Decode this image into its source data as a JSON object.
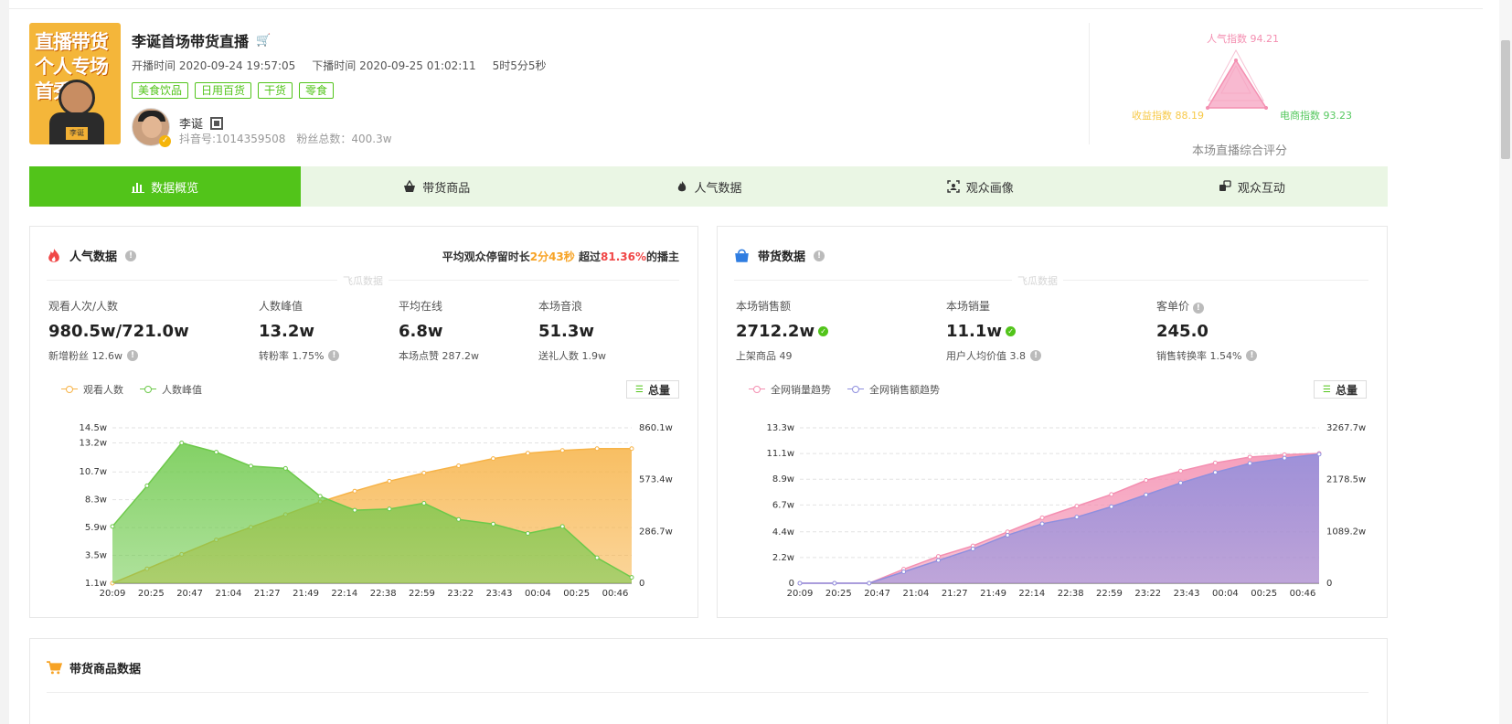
{
  "room": {
    "cover_text": "直播带货个人专场首秀",
    "cover_name": "李诞",
    "title": "李诞首场带货直播",
    "start_label": "开播时间",
    "start_time": "2020-09-24 19:57:05",
    "end_label": "下播时间",
    "end_time": "2020-09-25 01:02:11",
    "duration": "5时5分5秒",
    "tags": [
      "美食饮品",
      "日用百货",
      "干货",
      "零食"
    ]
  },
  "anchor": {
    "name": "李诞",
    "douyin_id": "抖音号:1014359508",
    "fans": "粉丝总数：400.3w"
  },
  "radar": {
    "popularity": "人气指数 94.21",
    "revenue": "收益指数 88.19",
    "ecommerce": "电商指数 93.23",
    "caption": "本场直播综合评分",
    "colors": {
      "popularity": "#f48fb1",
      "revenue": "#f7c948",
      "ecommerce": "#56c85f"
    }
  },
  "tabs": [
    {
      "label": "数据概览",
      "icon": "bar-chart-icon"
    },
    {
      "label": "带货商品",
      "icon": "basket-icon"
    },
    {
      "label": "人气数据",
      "icon": "flame-icon"
    },
    {
      "label": "观众画像",
      "icon": "portrait-icon"
    },
    {
      "label": "观众互动",
      "icon": "interaction-icon"
    }
  ],
  "popularity": {
    "title": "人气数据",
    "note_prefix": "平均观众停留时长",
    "stay_time": "2分43秒",
    "note_mid": "超过",
    "percent": "81.36%",
    "note_suffix": "的播主",
    "watermark": "飞瓜数据",
    "metrics": [
      {
        "label": "观看人次/人数",
        "value": "980.5w/721.0w",
        "sub": "新增粉丝 12.6w"
      },
      {
        "label": "人数峰值",
        "value": "13.2w",
        "sub": "转粉率 1.75%"
      },
      {
        "label": "平均在线",
        "value": "6.8w",
        "sub": "本场点赞 287.2w"
      },
      {
        "label": "本场音浪",
        "value": "51.3w",
        "sub": "送礼人数 1.9w"
      }
    ],
    "legend": [
      "观看人数",
      "人数峰值"
    ],
    "total_label": "总量"
  },
  "sales": {
    "title": "带货数据",
    "watermark": "飞瓜数据",
    "metrics": [
      {
        "label": "本场销售额",
        "value": "2712.2w",
        "sub": "上架商品 49"
      },
      {
        "label": "本场销量",
        "value": "11.1w",
        "sub": "用户人均价值 3.8"
      },
      {
        "label": "客单价",
        "value": "245.0",
        "sub": "销售转换率 1.54%"
      }
    ],
    "legend": [
      "全网销量趋势",
      "全网销售额趋势"
    ],
    "total_label": "总量"
  },
  "bottom": {
    "title": "带货商品数据"
  },
  "chart_data": [
    {
      "type": "area",
      "x": [
        "20:09",
        "20:25",
        "20:47",
        "21:04",
        "21:27",
        "21:49",
        "22:14",
        "22:38",
        "22:59",
        "23:22",
        "23:43",
        "00:04",
        "00:25",
        "00:46"
      ],
      "left_ticks": [
        "1.1w",
        "3.5w",
        "5.9w",
        "8.3w",
        "10.7w",
        "13.2w",
        "14.5w"
      ],
      "right_ticks": [
        "0",
        "286.7w",
        "573.4w",
        "860.1w"
      ],
      "ylim": [
        1.1,
        14.5
      ],
      "y2lim": [
        0,
        860.1
      ],
      "series": [
        {
          "name": "观看人数",
          "axis": "right",
          "color": "#f7b347",
          "values": [
            0,
            80,
            160,
            240,
            310,
            380,
            450,
            510,
            565,
            610,
            650,
            690,
            720,
            735,
            745,
            745
          ]
        },
        {
          "name": "人数峰值",
          "axis": "left",
          "color": "#6dc94a",
          "values": [
            6.0,
            9.5,
            13.2,
            12.4,
            11.2,
            11.0,
            8.6,
            7.4,
            7.5,
            8.0,
            6.6,
            6.2,
            5.4,
            6.0,
            3.3,
            1.6
          ]
        }
      ]
    },
    {
      "type": "area",
      "x": [
        "20:09",
        "20:25",
        "20:47",
        "21:04",
        "21:27",
        "21:49",
        "22:14",
        "22:38",
        "22:59",
        "23:22",
        "23:43",
        "00:04",
        "00:25",
        "00:46"
      ],
      "left_ticks": [
        "0",
        "2.2w",
        "4.4w",
        "6.7w",
        "8.9w",
        "11.1w",
        "13.3w"
      ],
      "right_ticks": [
        "0",
        "1089.2w",
        "2178.5w",
        "3267.7w"
      ],
      "ylim": [
        0,
        13.3
      ],
      "y2lim": [
        0,
        3267.7
      ],
      "series": [
        {
          "name": "全网销量趋势",
          "axis": "left",
          "color": "#f48fb1",
          "values": [
            0,
            0,
            0,
            1.2,
            2.3,
            3.2,
            4.4,
            5.6,
            6.6,
            7.6,
            8.8,
            9.6,
            10.3,
            10.8,
            11.0,
            11.1
          ]
        },
        {
          "name": "全网销售额趋势",
          "axis": "right",
          "color": "#8f8fde",
          "values": [
            0,
            0,
            0,
            240,
            480,
            720,
            1010,
            1250,
            1390,
            1610,
            1860,
            2110,
            2330,
            2520,
            2630,
            2712
          ]
        }
      ]
    }
  ]
}
